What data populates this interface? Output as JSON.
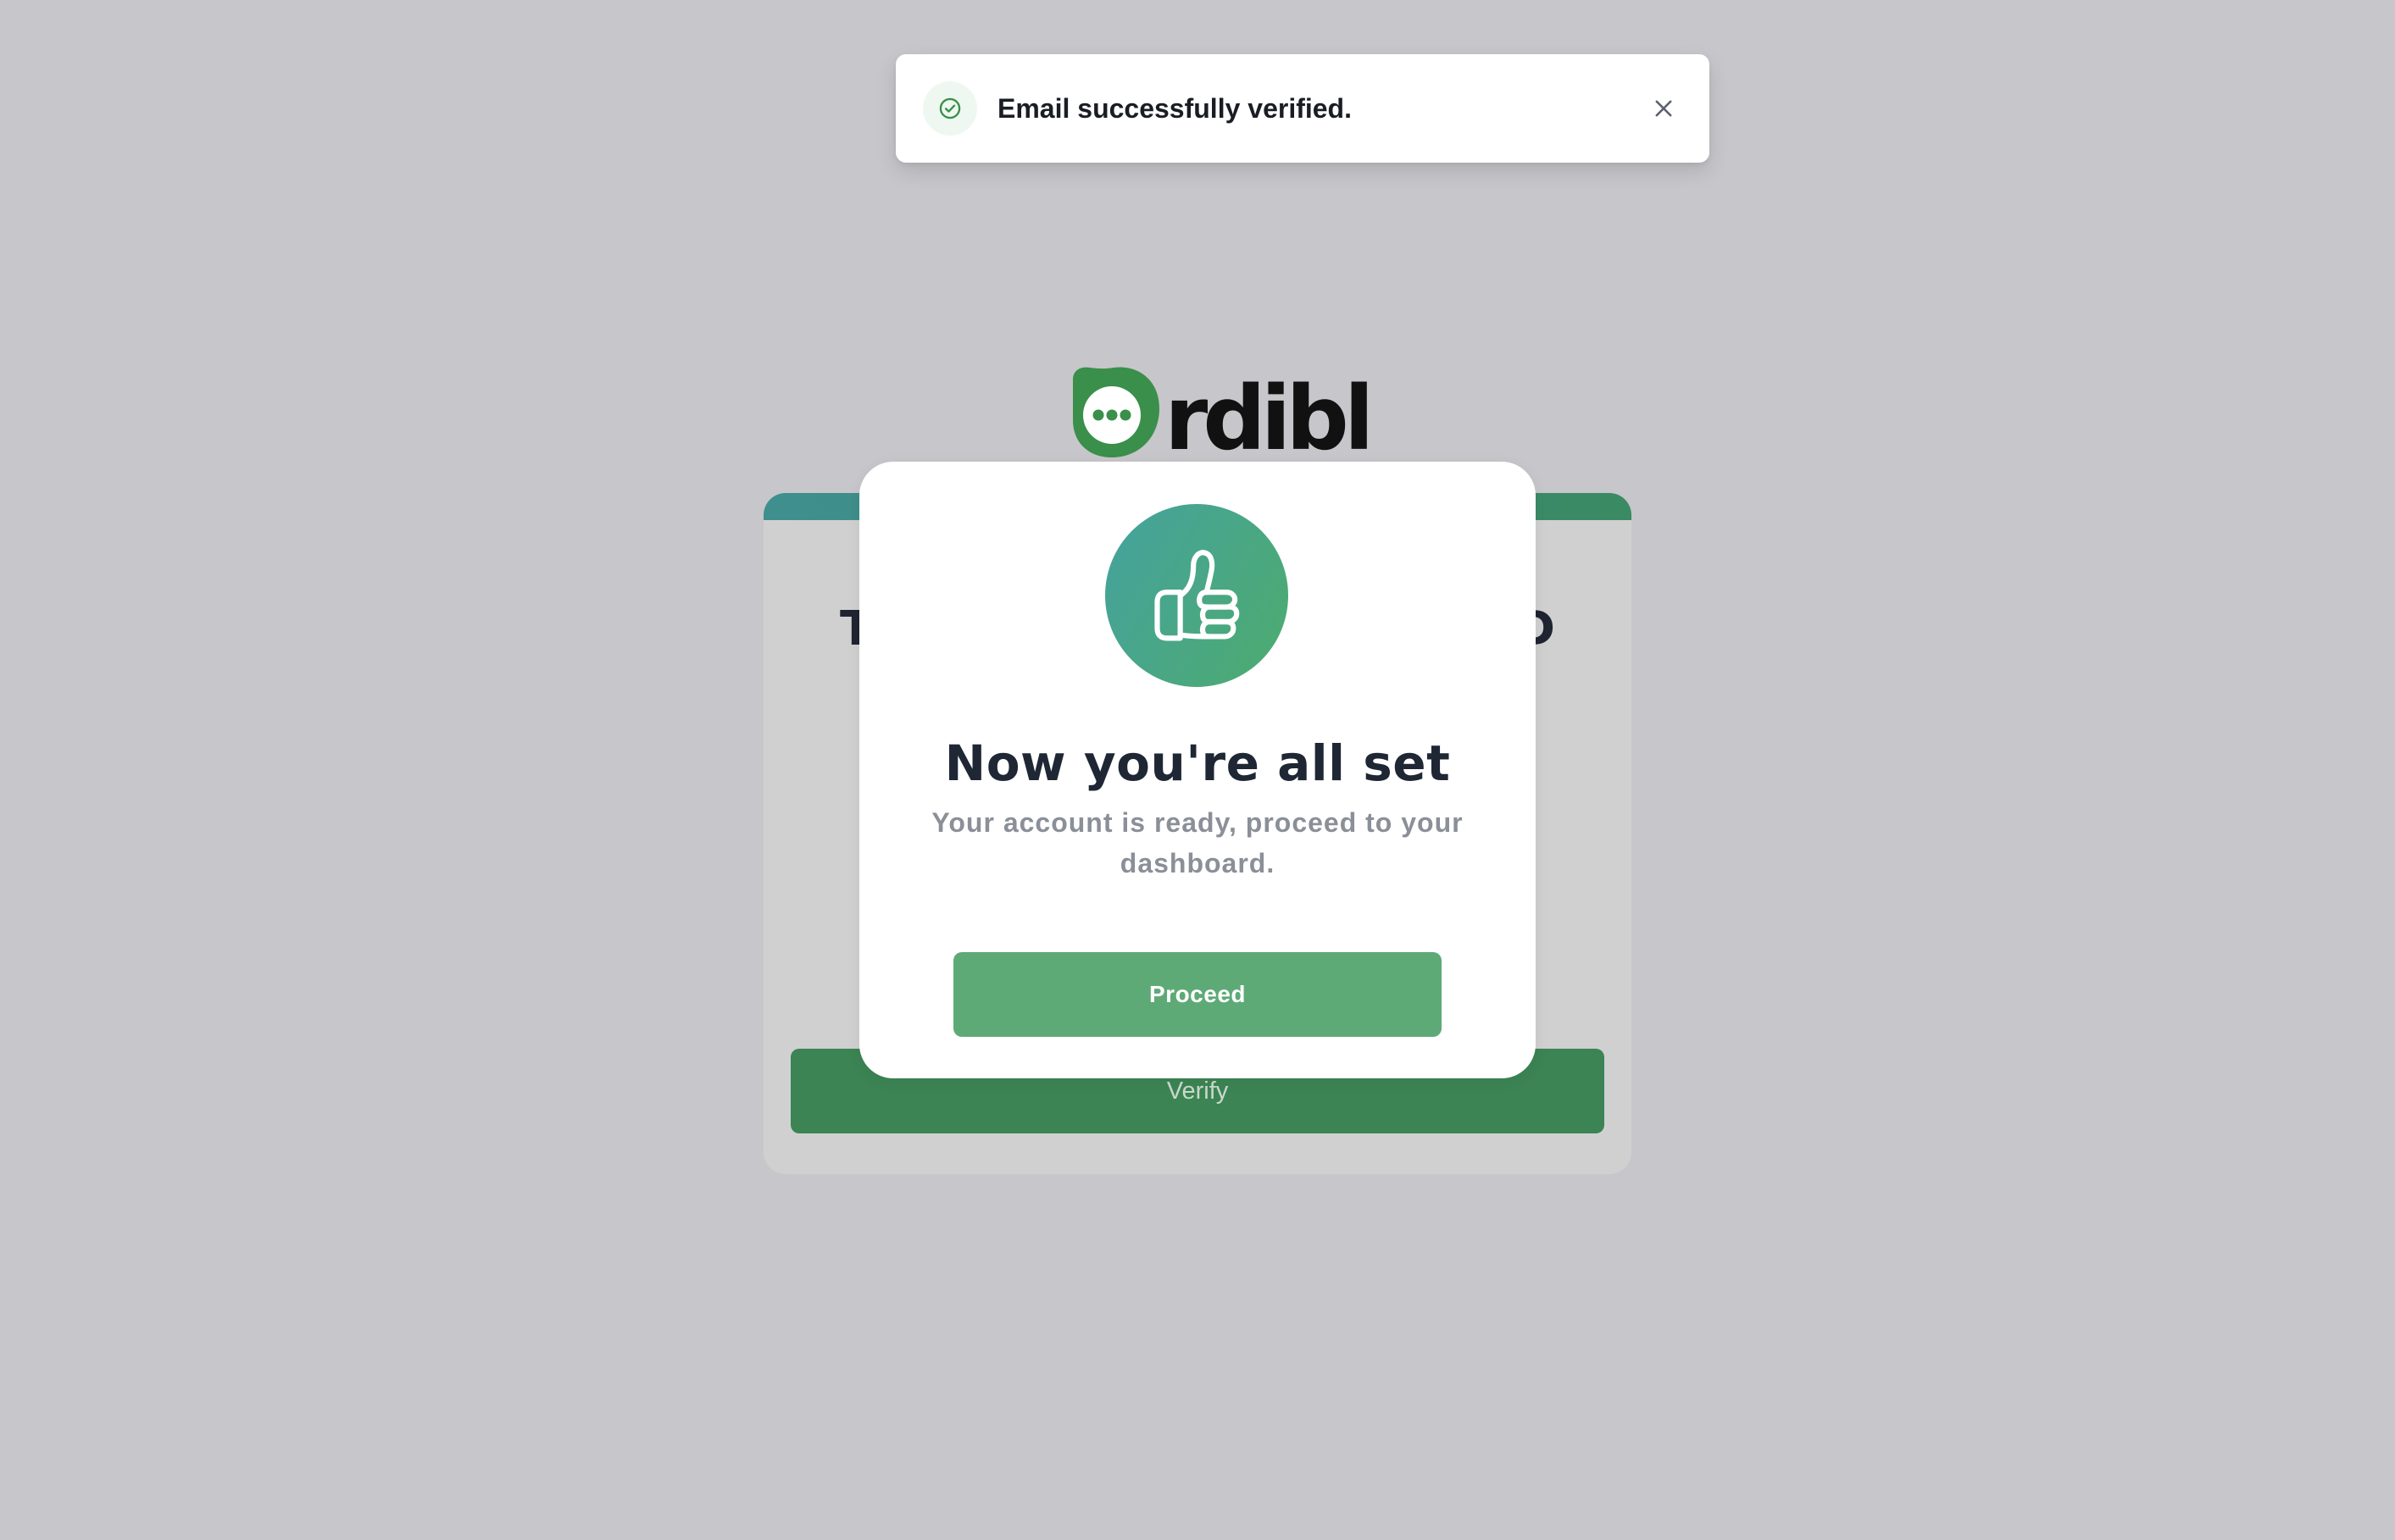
{
  "toast": {
    "icon": "check-circle-icon",
    "message": "Email successfully verified.",
    "close_icon": "close-icon"
  },
  "logo": {
    "text": "rdibl",
    "mark_icon": "speech-bubble-logo-icon"
  },
  "background_card": {
    "heading_left": "T",
    "heading_right": "D",
    "verify_label": "Verify"
  },
  "modal": {
    "icon": "thumbs-up-icon",
    "title": "Now you're all set",
    "subtitle": "Your account is ready, proceed to your dashboard.",
    "proceed_label": "Proceed"
  },
  "colors": {
    "brand_green": "#3a8f4a",
    "button_green": "#5eaa77",
    "overlay_gray": "#c7c6ca",
    "gradient_start": "#45a29e",
    "gradient_end": "#4dab6e"
  }
}
